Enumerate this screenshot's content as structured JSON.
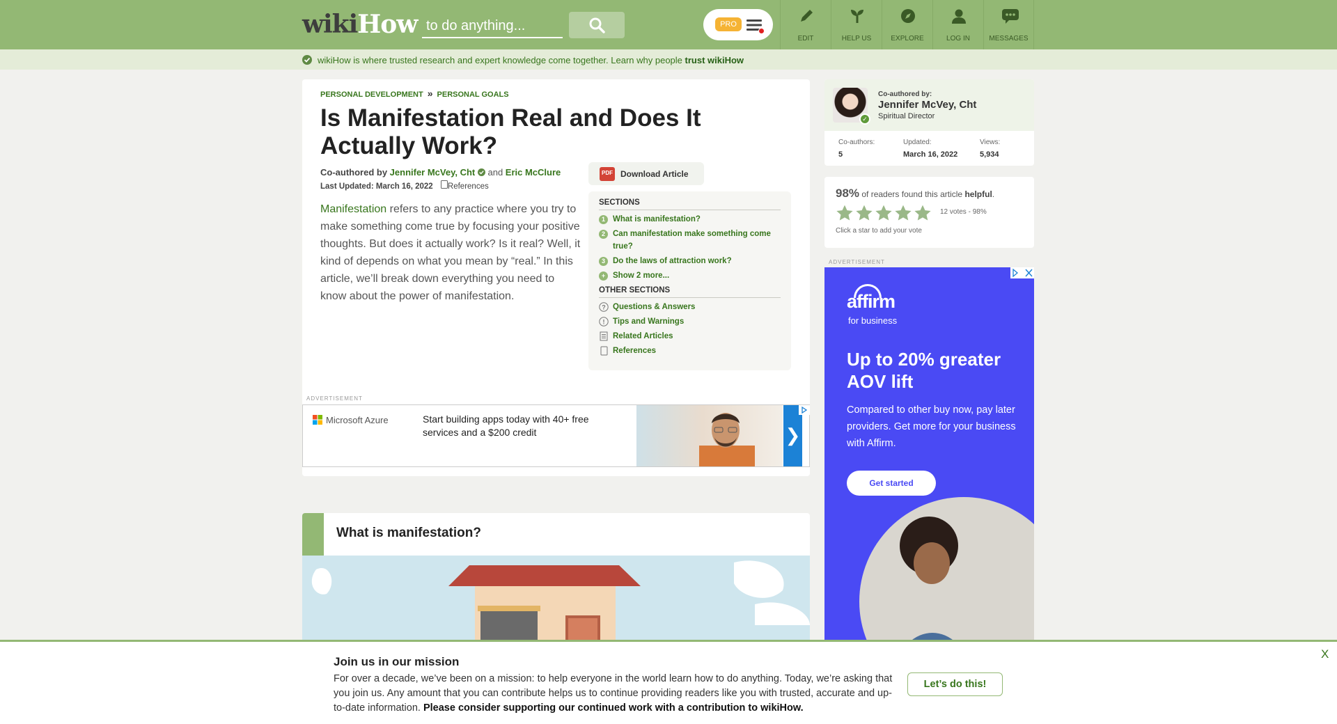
{
  "header": {
    "logo_wiki": "wiki",
    "logo_how": "How",
    "search_placeholder": "to do anything...",
    "pro_badge": "PRO",
    "nav": [
      {
        "label": "EDIT",
        "icon": "pencil-icon"
      },
      {
        "label": "HELP US",
        "icon": "sprout-icon"
      },
      {
        "label": "EXPLORE",
        "icon": "compass-icon"
      },
      {
        "label": "LOG IN",
        "icon": "user-icon"
      },
      {
        "label": "MESSAGES",
        "icon": "chat-icon"
      }
    ]
  },
  "trust_bar": {
    "text": "wikiHow is where trusted research and expert knowledge come together. Learn why people ",
    "link": "trust wikiHow"
  },
  "article": {
    "breadcrumb": [
      "PERSONAL DEVELOPMENT",
      "PERSONAL GOALS"
    ],
    "breadcrumb_sep": "»",
    "title": "Is Manifestation Real and Does It Actually Work?",
    "byline_prefix": "Co-authored by ",
    "author_1": "Jennifer McVey, Cht",
    "byline_and": " and ",
    "author_2": "Eric McClure",
    "updated_label": "Last Updated: March 16, 2022",
    "references_label": "References",
    "intro_keyword": "Manifestation",
    "intro_rest": " refers to any practice where you try to make something come true by focusing your positive thoughts. But does it actually work? Is it real? Well, it kind of depends on what you mean by “real.” In this article, we’ll break down everything you need to know about the power of manifestation.",
    "download_label": "Download Article",
    "pdf_badge": "PDF",
    "sections_heading": "SECTIONS",
    "sections": [
      {
        "num": "1",
        "label": "What is manifestation?"
      },
      {
        "num": "2",
        "label": "Can manifestation make something come true?"
      },
      {
        "num": "3",
        "label": "Do the laws of attraction work?"
      },
      {
        "num": "+",
        "label": "Show 2 more..."
      }
    ],
    "other_heading": "OTHER SECTIONS",
    "other_sections": [
      {
        "label": "Questions & Answers",
        "icon": "question-icon"
      },
      {
        "label": "Tips and Warnings",
        "icon": "warning-icon"
      },
      {
        "label": "Related Articles",
        "icon": "document-icon"
      },
      {
        "label": "References",
        "icon": "bookmark-icon"
      }
    ],
    "step_title": "What is manifestation?"
  },
  "ads": {
    "label": "ADVERTISEMENT",
    "azure_brand": "Microsoft Azure",
    "azure_text": "Start building apps today with 40+ free services and a $200 credit",
    "azure_next": "❯",
    "affirm_logo": "affirm",
    "affirm_sub": "for business",
    "affirm_head": "Up to 20% greater AOV lift",
    "affirm_body": "Compared to other buy now, pay later providers. Get more for your business with Affirm.",
    "affirm_cta": "Get started"
  },
  "author_card": {
    "coauth_label": "Co-authored by:",
    "name": "Jennifer McVey, Cht",
    "role": "Spiritual Director",
    "stats": [
      {
        "label": "Co-authors:",
        "value": "5"
      },
      {
        "label": "Updated:",
        "value": "March 16, 2022"
      },
      {
        "label": "Views:",
        "value": "5,934"
      }
    ]
  },
  "helpful": {
    "percent": "98%",
    "text_mid": " of readers found this article ",
    "text_bold": "helpful",
    "text_end": ".",
    "stars_filled": 5,
    "votes": "12 votes - 98%",
    "hint": "Click a star to add your vote"
  },
  "mission": {
    "title": "Join us in our mission",
    "body": "For over a decade, we’ve been on a mission: to help everyone in the world learn how to do anything. Today, we’re asking that you join us. Any amount that you can contribute helps us to continue providing readers like you with trusted, accurate and up-to-date information. ",
    "body_bold": "Please consider supporting our continued work with a contribution to wikiHow.",
    "cta": "Let’s do this!",
    "close": "X"
  },
  "colors": {
    "brand_green": "#93b874",
    "link_green": "#38761d",
    "affirm_blue": "#4a4af4",
    "azure_blue": "#1c82d6"
  }
}
